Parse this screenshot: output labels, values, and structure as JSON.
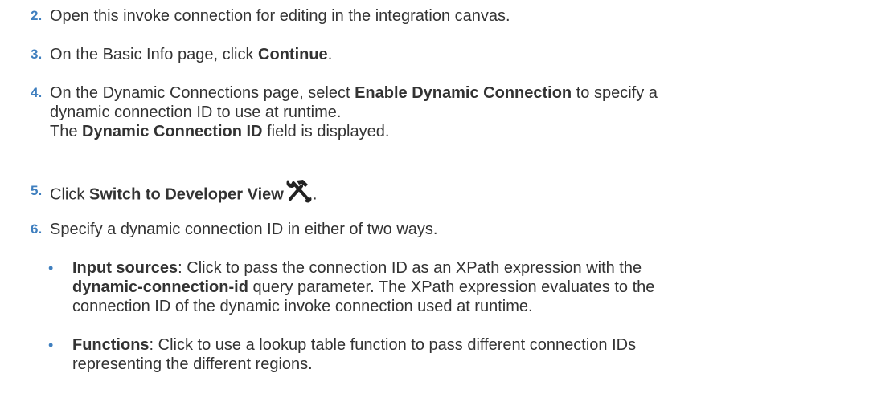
{
  "steps": [
    {
      "number": "2.",
      "line1": "Open this invoke connection for editing in the integration canvas."
    },
    {
      "number": "3.",
      "prefix": "On the Basic Info page, click ",
      "bold": "Continue",
      "suffix": "."
    },
    {
      "number": "4.",
      "prefix": "On the Dynamic Connections page, select ",
      "bold": "Enable Dynamic Connection",
      "suffix": " to specify a",
      "line2": "dynamic connection ID to use at runtime.",
      "line3_prefix": "The ",
      "line3_bold": "Dynamic Connection ID",
      "line3_suffix": " field is displayed."
    },
    {
      "number": "5.",
      "prefix": "Click ",
      "bold": "Switch to Developer View",
      "suffix": ".",
      "icon": "developer-view-tools-icon"
    },
    {
      "number": "6.",
      "line1": "Specify a dynamic connection ID in either of two ways."
    }
  ],
  "bullets": [
    {
      "bullet": "•",
      "bold": "Input sources",
      "line1_suffix": ": Click to pass the connection ID as an XPath expression with the",
      "line2_bold": "dynamic-connection-id",
      "line2_suffix": " query parameter. The XPath expression evaluates to the",
      "line3": "connection ID of the dynamic invoke connection used at runtime."
    },
    {
      "bullet": "•",
      "bold": "Functions",
      "line1_suffix": ": Click to use a lookup table function to pass different connection IDs",
      "line2": "representing the different regions."
    }
  ],
  "colors": {
    "accent": "#3f7fbf",
    "text": "#333333"
  }
}
